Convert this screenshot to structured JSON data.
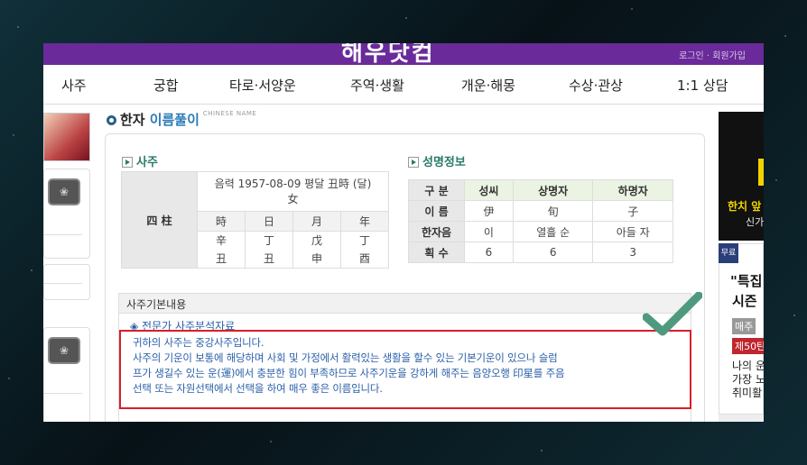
{
  "header": {
    "logo": "해우닷컴",
    "toplinks": "로그인 · 회원가입"
  },
  "nav": {
    "items": [
      "사주",
      "궁합",
      "타로·서양운",
      "주역·생활",
      "개운·해몽",
      "수상·관상",
      "1:1 상담"
    ]
  },
  "title": {
    "main": "한자",
    "highlight": "이름풀이",
    "sub": "CHINESE NAME"
  },
  "saju": {
    "heading": "사주",
    "lunar": "음력 1957-08-09 평달 丑時 (달)",
    "gender": "女",
    "row_label": "四 柱",
    "cols": [
      "時",
      "日",
      "月",
      "年"
    ],
    "top": [
      "辛",
      "丁",
      "戊",
      "丁"
    ],
    "bottom": [
      "丑",
      "丑",
      "申",
      "酉"
    ]
  },
  "name_info": {
    "heading": "성명정보",
    "headers": [
      "구 분",
      "성씨",
      "상명자",
      "하명자"
    ],
    "rows": [
      {
        "label": "이 름",
        "values": [
          "伊",
          "旬",
          "子"
        ]
      },
      {
        "label": "한자음",
        "values": [
          "이",
          "열흘 순",
          "아들 자"
        ]
      },
      {
        "label": "획 수",
        "values": [
          "6",
          "6",
          "3"
        ]
      }
    ]
  },
  "basic": {
    "heading": "사주기본내용",
    "subheading": "◈ 전문가 사주분석자료",
    "line1": "귀하의 사주는 중강사주입니다.",
    "line2": "사주의 기운이 보통에 해당하며 사회 및 가정에서 활력있는 생활을 할수 있는 기본기운이 있으나 슬럼",
    "line3": "프가 생길수 있는 운(運)에서 충분한 힘이 부족하므로 사주기운을 강하게 해주는 음양오행 印星를 주음",
    "line4": "선택 또는 자원선택에서 선택을 하여 매우 좋은 이름입니다."
  },
  "ads": {
    "ad1_line1": "한치 앞",
    "ad1_line2": "신가",
    "ad2_badge": "무료",
    "ad2_line1": "\"특집",
    "ad2_line2": "시즌",
    "ad2_tag1": "매주",
    "ad2_tag2": "제50탄",
    "ad2_text": "나의 운\n가장 노\n취미활"
  },
  "colors": {
    "accent": "#6a2a9a",
    "highlight_border": "#d61f2a",
    "check": "#4f9a7e",
    "text_blue": "#2a5fa8"
  }
}
